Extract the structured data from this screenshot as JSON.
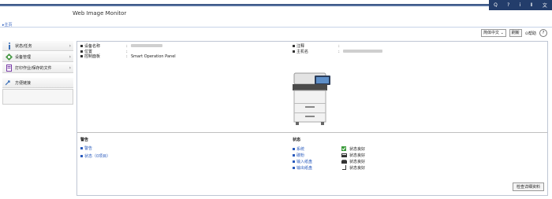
{
  "header": {
    "title": "Web Image Monitor",
    "top_icons": [
      "search-icon",
      "help-icon",
      "info-icon",
      "menu-icon"
    ],
    "top_labels": [
      "Q",
      "?",
      "i",
      "Ⅱ",
      "文"
    ]
  },
  "breadcrumb": {
    "home": "▸主页"
  },
  "tools": {
    "language": "简体中文",
    "refresh": "刷新",
    "help": "帮助",
    "help_icon": "?"
  },
  "sidebar": {
    "items": [
      {
        "label": "状态/任务",
        "icon": "info-icon"
      },
      {
        "label": "设备管理",
        "icon": "device-icon"
      },
      {
        "label": "打印作业/保存的文件",
        "icon": "document-icon"
      }
    ],
    "extra": {
      "label": "方便链接",
      "icon": "link-icon"
    }
  },
  "device_info": {
    "left": [
      {
        "key": "设备名称",
        "sep": ":",
        "value": ""
      },
      {
        "key": "位置",
        "sep": ":",
        "value": ""
      },
      {
        "key": "控制面板",
        "sep": ":",
        "value": "Smart Operation Panel"
      }
    ],
    "right": [
      {
        "key": "注释",
        "sep": ":",
        "value": ""
      },
      {
        "key": "主机名",
        "sep": ":",
        "value": ""
      }
    ]
  },
  "alerts": {
    "title": "警告",
    "items": [
      "警告",
      "状态（0项目）"
    ]
  },
  "status": {
    "title": "状态",
    "rows": [
      {
        "name": "系统",
        "value": "状态良好",
        "icon": "system-ok-icon"
      },
      {
        "name": "碳粉",
        "value": "状态良好",
        "icon": "toner-icon"
      },
      {
        "name": "输入纸盘",
        "value": "状态良好",
        "icon": "input-tray-icon"
      },
      {
        "name": "输出纸盘",
        "value": "状态良好",
        "icon": "output-tray-icon"
      }
    ]
  },
  "detail_button": "检查详细资料"
}
